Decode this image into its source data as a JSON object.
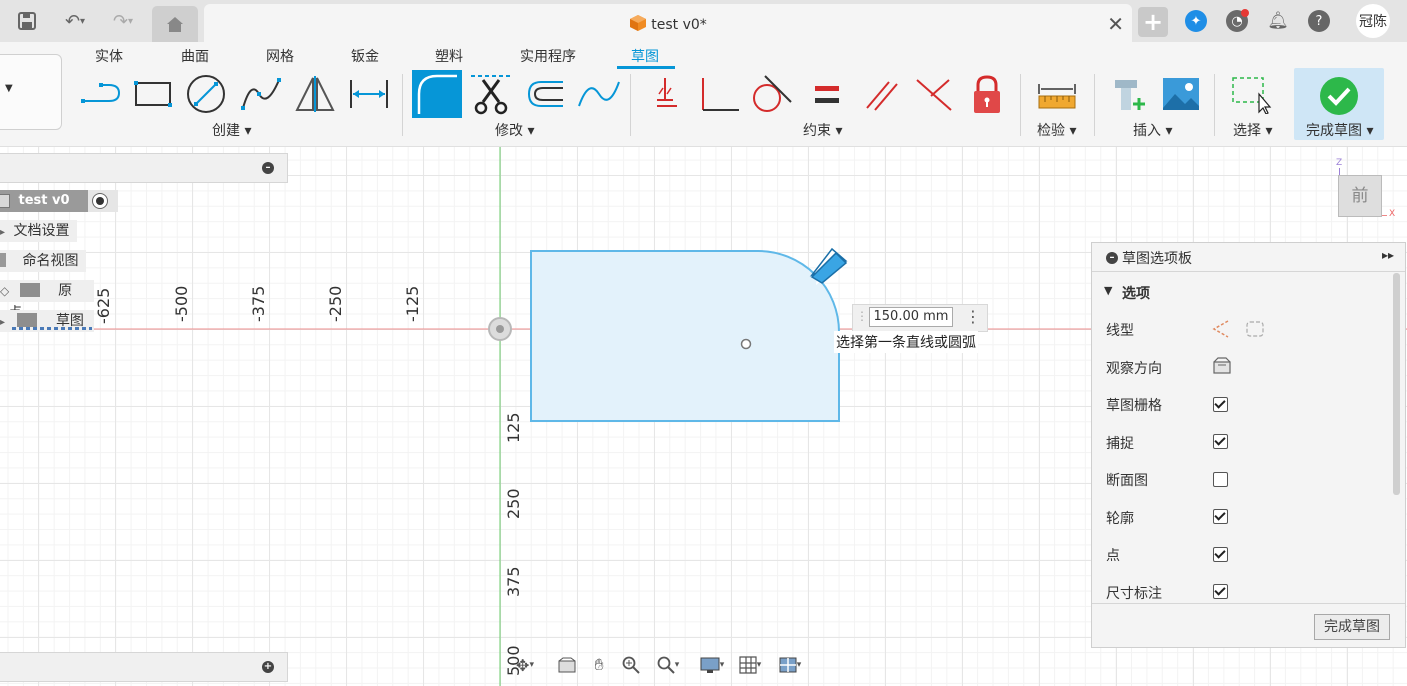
{
  "titlebar": {
    "document_title": "test v0*",
    "user_name": "冠陈"
  },
  "ribbon": {
    "tabs": [
      "实体",
      "曲面",
      "网格",
      "钣金",
      "塑料",
      "实用程序",
      "草图"
    ],
    "active_tab": "草图",
    "groups": {
      "create": "创建 ▾",
      "modify": "修改 ▾",
      "constraints": "约束 ▾",
      "inspect": "检验 ▾",
      "insert": "插入 ▾",
      "select": "选择 ▾",
      "finish": "完成草图 ▾"
    }
  },
  "browser": {
    "root_label": "test v0",
    "items": [
      "文档设置",
      "命名视图",
      "原点",
      "草图"
    ]
  },
  "axes": {
    "h_ticks": [
      "-625",
      "-500",
      "-375",
      "-250",
      "-125"
    ],
    "v_ticks": [
      "125",
      "250",
      "375",
      "500"
    ]
  },
  "sketch": {
    "dimension_value": "150.00 mm",
    "prompt": "选择第一条直线或圆弧"
  },
  "palette": {
    "title": "草图选项板",
    "section": "选项",
    "options": [
      {
        "label": "线型",
        "kind": "icons"
      },
      {
        "label": "观察方向",
        "kind": "icon"
      },
      {
        "label": "草图栅格",
        "checked": true
      },
      {
        "label": "捕捉",
        "checked": true
      },
      {
        "label": "断面图",
        "checked": false
      },
      {
        "label": "轮廓",
        "checked": true
      },
      {
        "label": "点",
        "checked": true
      },
      {
        "label": "尺寸标注",
        "checked": true
      }
    ],
    "finish_button": "完成草图"
  },
  "viewcube": {
    "face_label": "前",
    "axis_z": "Z",
    "axis_x": "X"
  },
  "colors": {
    "accent": "#0696d7",
    "constraint_red": "#d42b2b",
    "sketch_fill": "#e3f2fb",
    "sketch_stroke": "#5fb8e8",
    "finish_green": "#2db84a"
  }
}
